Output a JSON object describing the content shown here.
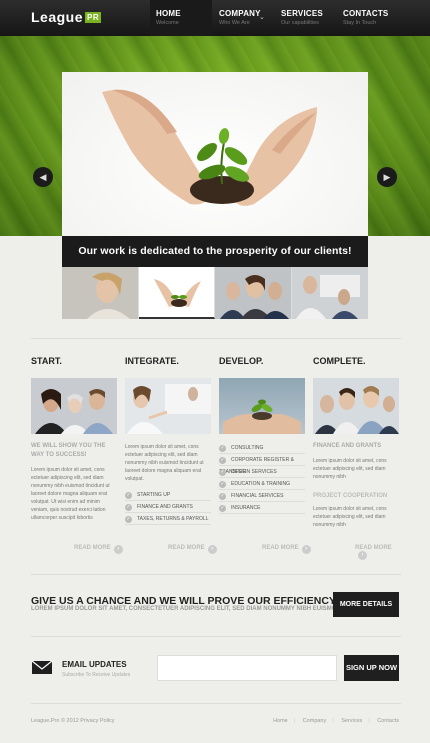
{
  "header": {
    "logo_text": "League",
    "logo_badge": "PR",
    "nav": [
      {
        "title": "Home",
        "subtitle": "Welcome"
      },
      {
        "title": "Company",
        "subtitle": "Who We Are"
      },
      {
        "title": "Services",
        "subtitle": "Our capabilities"
      },
      {
        "title": "Contacts",
        "subtitle": "Stay In Touch"
      }
    ]
  },
  "slider": {
    "caption": "Our work is dedicated to the prosperity of our clients!",
    "prev_icon": "chevron-left",
    "next_icon": "chevron-right"
  },
  "columns": [
    {
      "title": "Start.",
      "heading": "We will show you the way to success!",
      "text": "Lorem ipsum dolor sit amet, cons ectetuer adipiscing elit, sed diam nonummy nibh euismod tincidunt ut laoreet dolore magna aliquam erat volutpat. Ut wisi enim ad minim veniam, quis nostrud exerci tation ullamcorper suscipit lobortis",
      "read_more": "Read More"
    },
    {
      "title": "Integrate.",
      "text": "Lorem ipsum dolor sit amet, cons ectetuer adipiscing elit, sed diam nonummy nibh euismod tincidunt ut laoreet dolore magna aliquam erat volutpat.",
      "items": [
        "Starting Up",
        "Finance and Grants",
        "Taxes, Returns & Payroll"
      ],
      "read_more": "Read More"
    },
    {
      "title": "Develop.",
      "items": [
        "Consulting",
        "Corporate Register & Transfer",
        "Design Services",
        "Education & Training",
        "Financial Services",
        "Insurance"
      ],
      "read_more": "Read More"
    },
    {
      "title": "Complete.",
      "heading": "Finance and grants",
      "text": "Lorem ipsum dolor sit amet, cons ectetuer adipiscing elit, sed diam nonummy nibh",
      "heading2": "Project Cooperation",
      "text2": "Lorem ipsum dolor sit amet, cons ectetuer adipiscing elit, sed diam nonummy nibh",
      "read_more": "Read More"
    }
  ],
  "promo": {
    "title": "Give us a chance and we will prove our efficiency!",
    "subtitle": "Lorem ipsum dolor sit amet, consectetuer adipiscing elit, sed diam nonummy nibh euismod.",
    "button": "More Details"
  },
  "newsletter": {
    "title": "Email Updates",
    "subtitle": "Subscribe To Receive Updates",
    "input_value": "",
    "button": "Sign Up Now"
  },
  "footer": {
    "copyright": "League.Pro © 2012 Privacy Policy",
    "links": [
      "Home",
      "Company",
      "Services",
      "Contacts"
    ]
  },
  "colors": {
    "accent": "#7bb320",
    "dark": "#1f1f1f",
    "background": "#eeeeea"
  }
}
